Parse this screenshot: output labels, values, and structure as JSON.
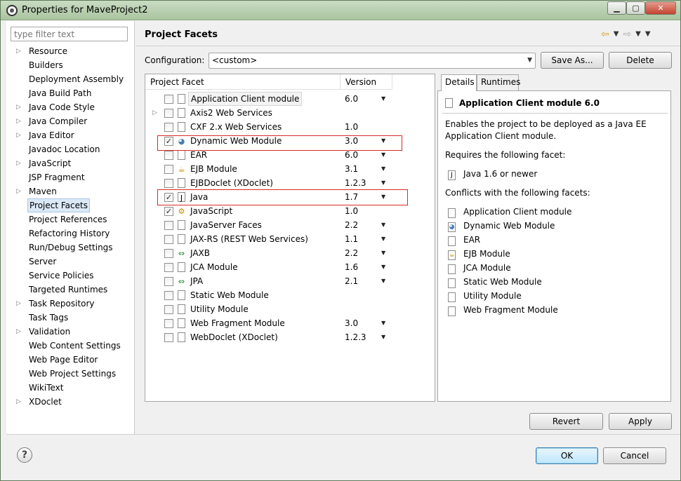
{
  "window": {
    "title": "Properties for MaveProject2",
    "minimize": "▁",
    "maximize": "▢",
    "close": "✕"
  },
  "filter": {
    "placeholder": "type filter text"
  },
  "tree": [
    {
      "label": "Resource",
      "expandable": true
    },
    {
      "label": "Builders",
      "expandable": false
    },
    {
      "label": "Deployment Assembly",
      "expandable": false
    },
    {
      "label": "Java Build Path",
      "expandable": false
    },
    {
      "label": "Java Code Style",
      "expandable": true
    },
    {
      "label": "Java Compiler",
      "expandable": true
    },
    {
      "label": "Java Editor",
      "expandable": true
    },
    {
      "label": "Javadoc Location",
      "expandable": false
    },
    {
      "label": "JavaScript",
      "expandable": true
    },
    {
      "label": "JSP Fragment",
      "expandable": false
    },
    {
      "label": "Maven",
      "expandable": true
    },
    {
      "label": "Project Facets",
      "expandable": false,
      "selected": true
    },
    {
      "label": "Project References",
      "expandable": false
    },
    {
      "label": "Refactoring History",
      "expandable": false
    },
    {
      "label": "Run/Debug Settings",
      "expandable": false
    },
    {
      "label": "Server",
      "expandable": false
    },
    {
      "label": "Service Policies",
      "expandable": false
    },
    {
      "label": "Targeted Runtimes",
      "expandable": false
    },
    {
      "label": "Task Repository",
      "expandable": true
    },
    {
      "label": "Task Tags",
      "expandable": false
    },
    {
      "label": "Validation",
      "expandable": true
    },
    {
      "label": "Web Content Settings",
      "expandable": false
    },
    {
      "label": "Web Page Editor",
      "expandable": false
    },
    {
      "label": "Web Project Settings",
      "expandable": false
    },
    {
      "label": "WikiText",
      "expandable": false
    },
    {
      "label": "XDoclet",
      "expandable": true
    }
  ],
  "page": {
    "title": "Project Facets"
  },
  "configuration": {
    "label": "Configuration:",
    "value": "<custom>",
    "save_as": "Save As...",
    "delete": "Delete"
  },
  "facets": {
    "headers": {
      "facet": "Project Facet",
      "version": "Version"
    },
    "rows": [
      {
        "name": "Application Client module",
        "version": "6.0",
        "checked": false,
        "dropdown": true,
        "icon": "doc",
        "selected": true
      },
      {
        "name": "Axis2 Web Services",
        "version": "",
        "checked": false,
        "dropdown": false,
        "icon": "doc",
        "expandable": true
      },
      {
        "name": "CXF 2.x Web Services",
        "version": "1.0",
        "checked": false,
        "dropdown": false,
        "icon": "doc"
      },
      {
        "name": "Dynamic Web Module",
        "version": "3.0",
        "checked": true,
        "dropdown": true,
        "icon": "gear"
      },
      {
        "name": "EAR",
        "version": "6.0",
        "checked": false,
        "dropdown": true,
        "icon": "doc"
      },
      {
        "name": "EJB Module",
        "version": "3.1",
        "checked": false,
        "dropdown": true,
        "icon": "bean"
      },
      {
        "name": "EJBDoclet (XDoclet)",
        "version": "1.2.3",
        "checked": false,
        "dropdown": true,
        "icon": "doc"
      },
      {
        "name": "Java",
        "version": "1.7",
        "checked": true,
        "dropdown": true,
        "icon": "java"
      },
      {
        "name": "JavaScript",
        "version": "1.0",
        "checked": true,
        "dropdown": false,
        "icon": "js"
      },
      {
        "name": "JavaServer Faces",
        "version": "2.2",
        "checked": false,
        "dropdown": true,
        "icon": "doc"
      },
      {
        "name": "JAX-RS (REST Web Services)",
        "version": "1.1",
        "checked": false,
        "dropdown": true,
        "icon": "doc"
      },
      {
        "name": "JAXB",
        "version": "2.2",
        "checked": false,
        "dropdown": true,
        "icon": "arrows"
      },
      {
        "name": "JCA Module",
        "version": "1.6",
        "checked": false,
        "dropdown": true,
        "icon": "doc"
      },
      {
        "name": "JPA",
        "version": "2.1",
        "checked": false,
        "dropdown": true,
        "icon": "arrows"
      },
      {
        "name": "Static Web Module",
        "version": "",
        "checked": false,
        "dropdown": false,
        "icon": "doc"
      },
      {
        "name": "Utility Module",
        "version": "",
        "checked": false,
        "dropdown": false,
        "icon": "doc"
      },
      {
        "name": "Web Fragment Module",
        "version": "3.0",
        "checked": false,
        "dropdown": true,
        "icon": "doc"
      },
      {
        "name": "WebDoclet (XDoclet)",
        "version": "1.2.3",
        "checked": false,
        "dropdown": true,
        "icon": "doc"
      }
    ]
  },
  "details": {
    "tabs": [
      "Details",
      "Runtimes"
    ],
    "title": "Application Client module 6.0",
    "description": [
      "Enables the project to be deployed as a Java EE",
      "Application Client module."
    ],
    "requires_label": "Requires the following facet:",
    "requires": [
      {
        "name": "Java 1.6 or newer",
        "icon": "java"
      }
    ],
    "conflicts_label": "Conflicts with the following facets:",
    "conflicts": [
      {
        "name": "Application Client module",
        "icon": "doc"
      },
      {
        "name": "Dynamic Web Module",
        "icon": "gear"
      },
      {
        "name": "EAR",
        "icon": "doc"
      },
      {
        "name": "EJB Module",
        "icon": "bean"
      },
      {
        "name": "JCA Module",
        "icon": "doc"
      },
      {
        "name": "Static Web Module",
        "icon": "doc"
      },
      {
        "name": "Utility Module",
        "icon": "doc"
      },
      {
        "name": "Web Fragment Module",
        "icon": "doc"
      }
    ]
  },
  "buttons": {
    "revert": "Revert",
    "apply": "Apply",
    "ok": "OK",
    "cancel": "Cancel"
  },
  "glyphs": {
    "expand": "▷",
    "dropdown": "▼",
    "check": "✓",
    "back": "⇦",
    "forward": "⇨",
    "help": "?"
  }
}
